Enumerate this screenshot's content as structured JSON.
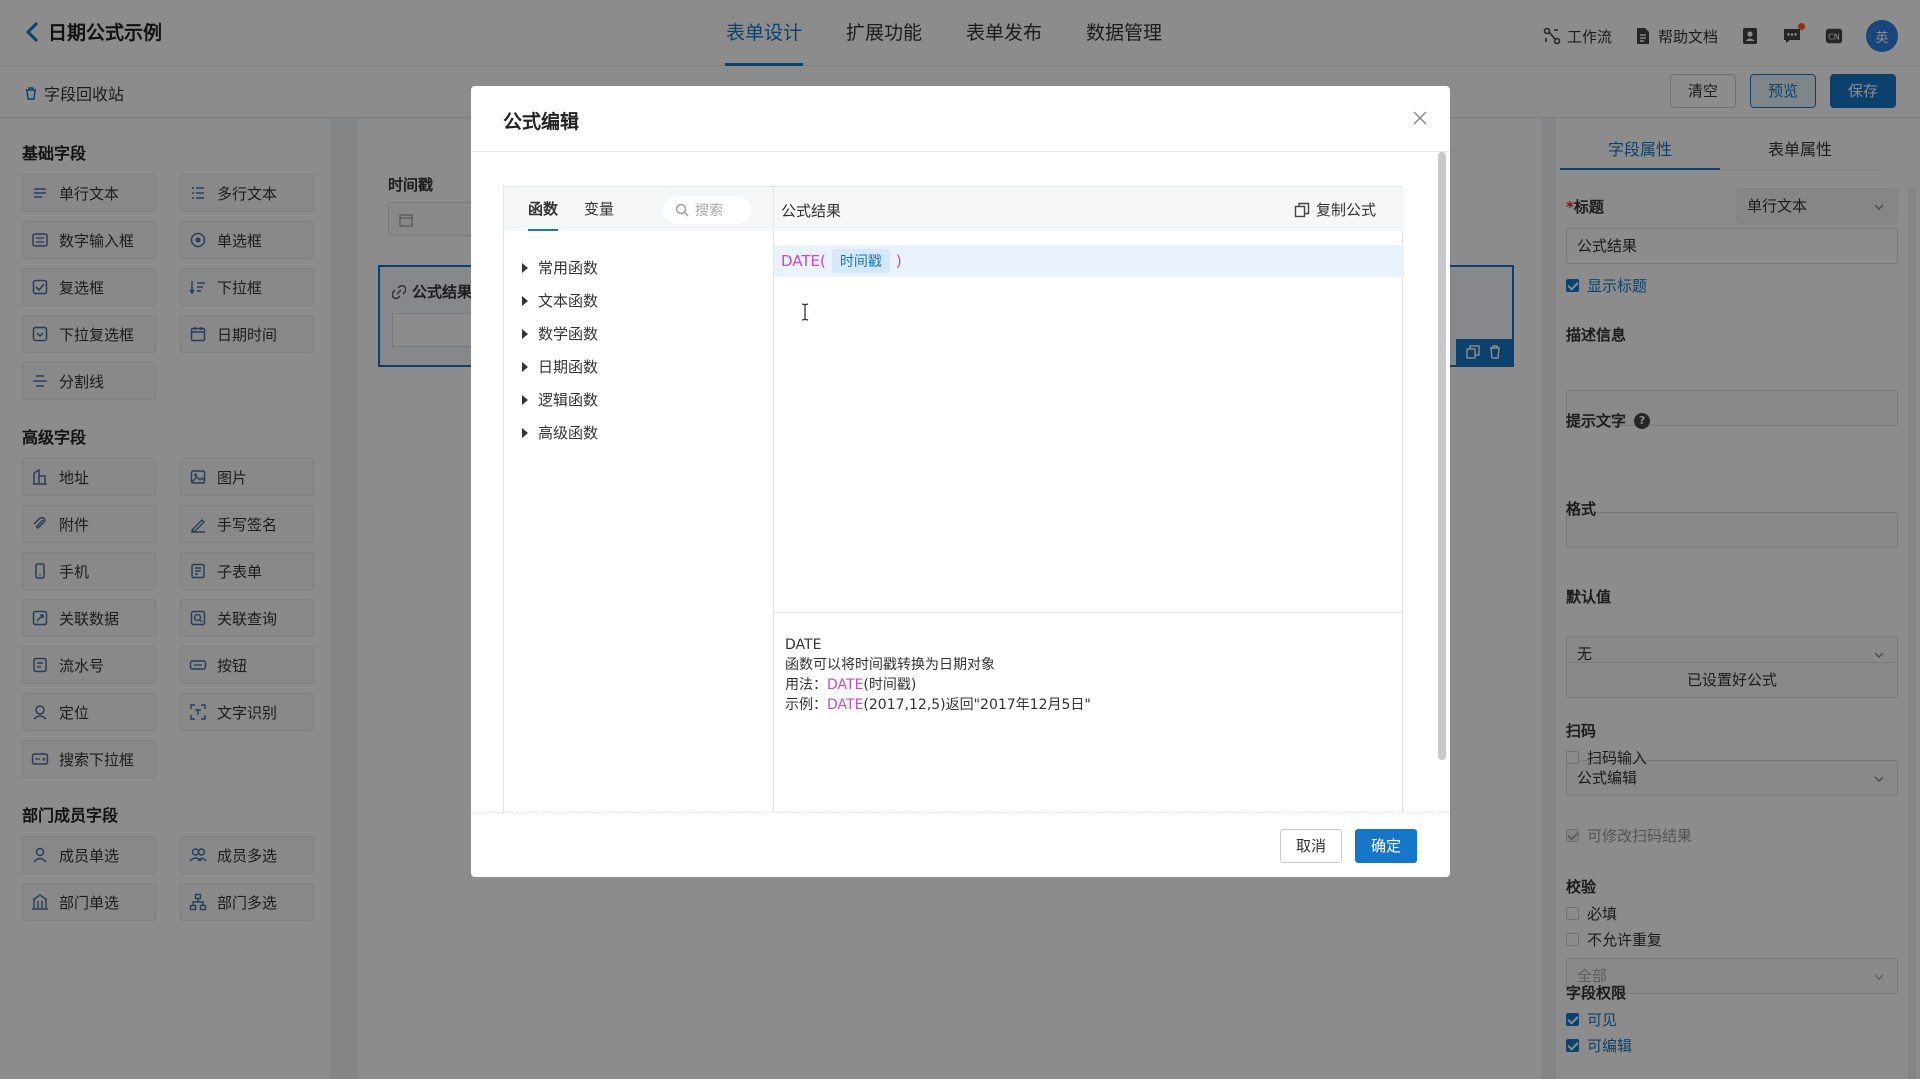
{
  "header": {
    "title": "日期公式示例",
    "tabs": [
      {
        "label": "表单设计"
      },
      {
        "label": "扩展功能"
      },
      {
        "label": "表单发布"
      },
      {
        "label": "数据管理"
      }
    ],
    "workflow_label": "工作流",
    "help_label": "帮助文档",
    "lang_label": "CN",
    "avatar_text": "英"
  },
  "toolbar": {
    "recycle_label": "字段回收站",
    "clear_label": "清空",
    "preview_label": "预览",
    "save_label": "保存"
  },
  "fields": {
    "basic_title": "基础字段",
    "basic": [
      {
        "label": "单行文本",
        "icon": "single-line-icon"
      },
      {
        "label": "多行文本",
        "icon": "multi-line-icon"
      },
      {
        "label": "数字输入框",
        "icon": "number-icon"
      },
      {
        "label": "单选框",
        "icon": "radio-icon"
      },
      {
        "label": "复选框",
        "icon": "checkbox-icon"
      },
      {
        "label": "下拉框",
        "icon": "dropdown-icon"
      },
      {
        "label": "下拉复选框",
        "icon": "multi-dropdown-icon"
      },
      {
        "label": "日期时间",
        "icon": "calendar-icon"
      },
      {
        "label": "分割线",
        "icon": "divider-icon"
      }
    ],
    "advanced_title": "高级字段",
    "advanced": [
      {
        "label": "地址",
        "icon": "address-icon"
      },
      {
        "label": "图片",
        "icon": "image-icon"
      },
      {
        "label": "附件",
        "icon": "attachment-icon"
      },
      {
        "label": "手写签名",
        "icon": "signature-icon"
      },
      {
        "label": "手机",
        "icon": "phone-icon"
      },
      {
        "label": "子表单",
        "icon": "subform-icon"
      },
      {
        "label": "关联数据",
        "icon": "link-data-icon"
      },
      {
        "label": "关联查询",
        "icon": "link-query-icon"
      },
      {
        "label": "流水号",
        "icon": "serial-icon"
      },
      {
        "label": "按钮",
        "icon": "button-icon"
      },
      {
        "label": "定位",
        "icon": "location-icon"
      },
      {
        "label": "文字识别",
        "icon": "ocr-icon"
      },
      {
        "label": "搜索下拉框",
        "icon": "search-dropdown-icon"
      }
    ],
    "member_title": "部门成员字段",
    "member": [
      {
        "label": "成员单选",
        "icon": "member-icon"
      },
      {
        "label": "成员多选",
        "icon": "members-icon"
      },
      {
        "label": "部门单选",
        "icon": "department-icon"
      },
      {
        "label": "部门多选",
        "icon": "departments-icon"
      }
    ]
  },
  "canvas": {
    "timestamp_label": "时间戳",
    "selected_label": "公式结果"
  },
  "props": {
    "tab_field": "字段属性",
    "tab_form": "表单属性",
    "title_label": "标题",
    "title_type": "单行文本",
    "title_value": "公式结果",
    "show_title": "显示标题",
    "desc_label": "描述信息",
    "hint_label": "提示文字",
    "format_label": "格式",
    "format_value": "无",
    "default_label": "默认值",
    "default_value": "公式编辑",
    "formula_set": "已设置好公式",
    "scan_label": "扫码",
    "scan_input": "扫码输入",
    "scan_scope": "全部",
    "scan_edit": "可修改扫码结果",
    "validate_label": "校验",
    "required": "必填",
    "no_repeat": "不允许重复",
    "perm_label": "字段权限",
    "visible": "可见",
    "editable": "可编辑"
  },
  "modal": {
    "title": "公式编辑",
    "tab_func": "函数",
    "tab_var": "变量",
    "search_placeholder": "搜索",
    "tree": [
      {
        "label": "常用函数"
      },
      {
        "label": "文本函数"
      },
      {
        "label": "数学函数"
      },
      {
        "label": "日期函数"
      },
      {
        "label": "逻辑函数"
      },
      {
        "label": "高级函数"
      }
    ],
    "result_label": "公式结果",
    "copy_label": "复制公式",
    "formula": {
      "fn": "DATE(",
      "arg": "时间戳",
      "close": ")"
    },
    "desc": {
      "name": "DATE",
      "summary": "函数可以将时间戳转换为日期对象",
      "usage_prefix": "用法：",
      "usage_fn": "DATE",
      "usage_rest": "(时间戳)",
      "example_prefix": "示例：",
      "example_fn": "DATE",
      "example_rest": "(2017,12,5)返回\"2017年12月5日\""
    },
    "cancel_label": "取消",
    "ok_label": "确定"
  },
  "colors": {
    "primary": "#1677c8",
    "func": "#c04dc4"
  }
}
